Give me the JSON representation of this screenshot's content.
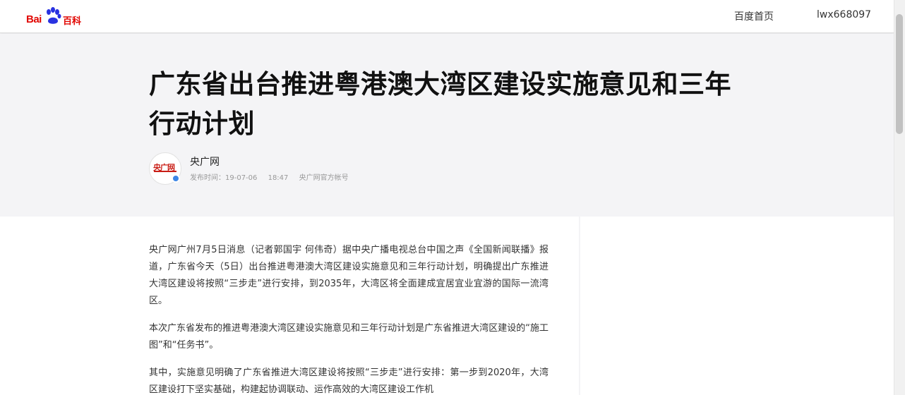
{
  "header": {
    "logo_bai": "Bai",
    "logo_baike": "百科",
    "nav_home": "百度首页",
    "username": "lwx668097"
  },
  "article": {
    "title": "广东省出台推进粤港澳大湾区建设实施意见和三年行动计划",
    "author": {
      "name": "央广网",
      "avatar_text": "央广网",
      "publish_label": "发布时间：",
      "publish_date": "19-07-06",
      "publish_time": "18:47",
      "account": "央广网官方帐号"
    },
    "paragraphs": [
      "央广网广州7月5日消息（记者郭国宇 何伟奇）据中央广播电视总台中国之声《全国新闻联播》报道，广东省今天（5日）出台推进粤港澳大湾区建设实施意见和三年行动计划，明确提出广东推进大湾区建设将按照“三步走”进行安排，到2035年，大湾区将全面建成宜居宜业宜游的国际一流湾区。",
      "本次广东省发布的推进粤港澳大湾区建设实施意见和三年行动计划是广东省推进大湾区建设的“施工图”和“任务书”。",
      "其中，实施意见明确了广东省推进大湾区建设将按照“三步走”进行安排：第一步到2020年，大湾区建设打下坚实基础，构建起协调联动、运作高效的大湾区建设工作机"
    ]
  },
  "colors": {
    "brand_red": "#e10601",
    "verified_blue": "#3d86e6"
  }
}
